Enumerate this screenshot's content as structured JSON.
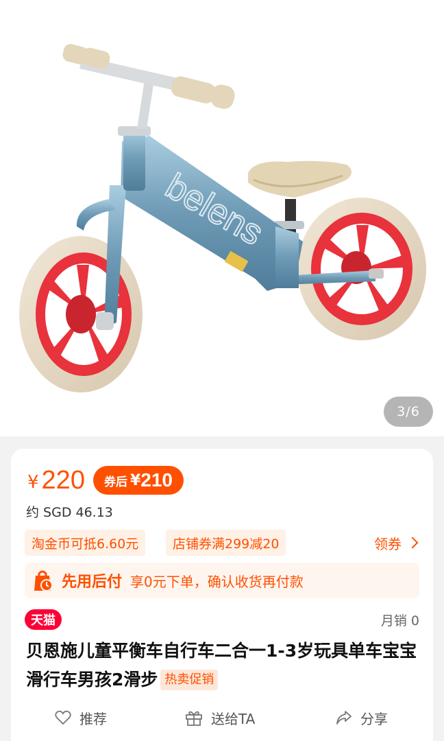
{
  "gallery": {
    "counter": "3/6",
    "brand_on_frame": "belens"
  },
  "price": {
    "currency_symbol": "¥",
    "value": "220",
    "coupon_label": "券后",
    "coupon_symbol": "¥",
    "coupon_value": "210",
    "sgd": "约 SGD 46.13"
  },
  "promos": {
    "gold_coin": "淘金币可抵6.60元",
    "store_coupon": "店铺券满299减20",
    "get_coupon": "领券"
  },
  "pay_later": {
    "title": "先用后付",
    "desc": "享0元下单，确认收货再付款"
  },
  "product": {
    "platform_badge": "天猫",
    "monthly_sales": "月销 0",
    "title": "贝恩施儿童平衡车自行车二合一1-3岁玩具单车宝宝滑行车男孩2滑步",
    "hot_tag": "热卖促销"
  },
  "actions": {
    "recommend": "推荐",
    "gift": "送给TA",
    "share": "分享"
  },
  "colors": {
    "accent": "#ff5000",
    "tmall_red": "#ff0036",
    "frame_blue": "#7fa9c4",
    "rim_red": "#e8323c",
    "tire_beige": "#e9dcc8"
  }
}
